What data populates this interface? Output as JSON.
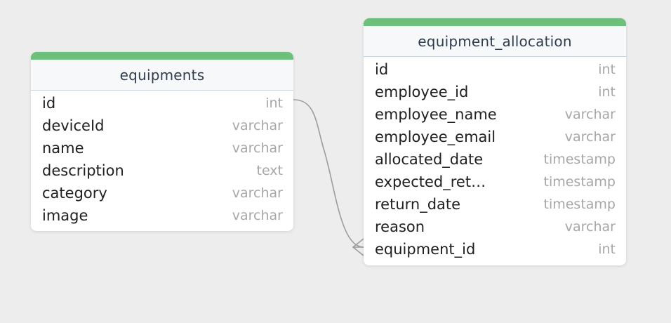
{
  "tables": {
    "equipments": {
      "name": "equipments",
      "fields": [
        {
          "name": "id",
          "type": "int"
        },
        {
          "name": "deviceId",
          "type": "varchar"
        },
        {
          "name": "name",
          "type": "varchar"
        },
        {
          "name": "description",
          "type": "text"
        },
        {
          "name": "category",
          "type": "varchar"
        },
        {
          "name": "image",
          "type": "varchar"
        }
      ]
    },
    "equipment_allocation": {
      "name": "equipment_allocation",
      "fields": [
        {
          "name": "id",
          "type": "int"
        },
        {
          "name": "employee_id",
          "type": "int"
        },
        {
          "name": "employee_name",
          "type": "varchar"
        },
        {
          "name": "employee_email",
          "type": "varchar"
        },
        {
          "name": "allocated_date",
          "type": "timestamp"
        },
        {
          "name": "expected_ret…",
          "type": "timestamp"
        },
        {
          "name": "return_date",
          "type": "timestamp"
        },
        {
          "name": "reason",
          "type": "varchar"
        },
        {
          "name": "equipment_id",
          "type": "int"
        }
      ]
    }
  },
  "relationship": {
    "from": "equipments.id",
    "to": "equipment_allocation.equipment_id",
    "cardinality": "one-to-many"
  },
  "colors": {
    "background": "#ededed",
    "header_accent": "#6cc07c",
    "header_bg": "#f6f8fa",
    "connector": "#9c9c9c"
  }
}
